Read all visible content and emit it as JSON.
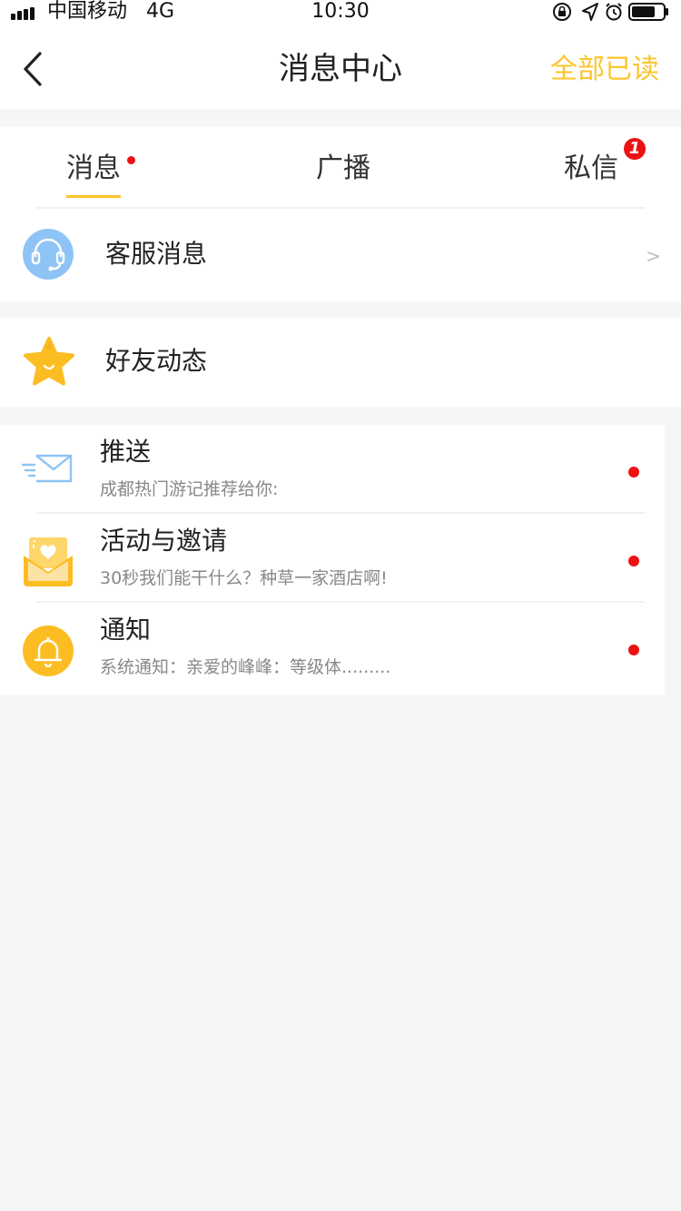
{
  "status_bar": {
    "carrier": "中国移动",
    "network": "4G",
    "time": "10:30"
  },
  "nav": {
    "title": "消息中心",
    "mark_all_read": "全部已读"
  },
  "tabs": [
    {
      "label": "消息",
      "active": true,
      "has_dot": true
    },
    {
      "label": "广播",
      "active": false
    },
    {
      "label": "私信",
      "active": false,
      "badge": "1"
    }
  ],
  "service_row": {
    "label": "客服消息",
    "chevron": ">"
  },
  "friends_row": {
    "label": "好友动态"
  },
  "messages": [
    {
      "title": "推送",
      "preview": "成都热门游记推荐给你:",
      "unread": true,
      "icon": "mail-icon"
    },
    {
      "title": "活动与邀请",
      "preview": "30秒我们能干什么？种草一家酒店啊!",
      "unread": true,
      "icon": "invitation-envelope-icon"
    },
    {
      "title": "通知",
      "preview": "系统通知：亲爱的峰峰：等级体.........",
      "unread": true,
      "icon": "bell-icon"
    }
  ],
  "colors": {
    "accent": "#fbc52b",
    "unread": "#ee1111",
    "service_icon": "#8ec4f5",
    "background": "#f6f6f6"
  }
}
